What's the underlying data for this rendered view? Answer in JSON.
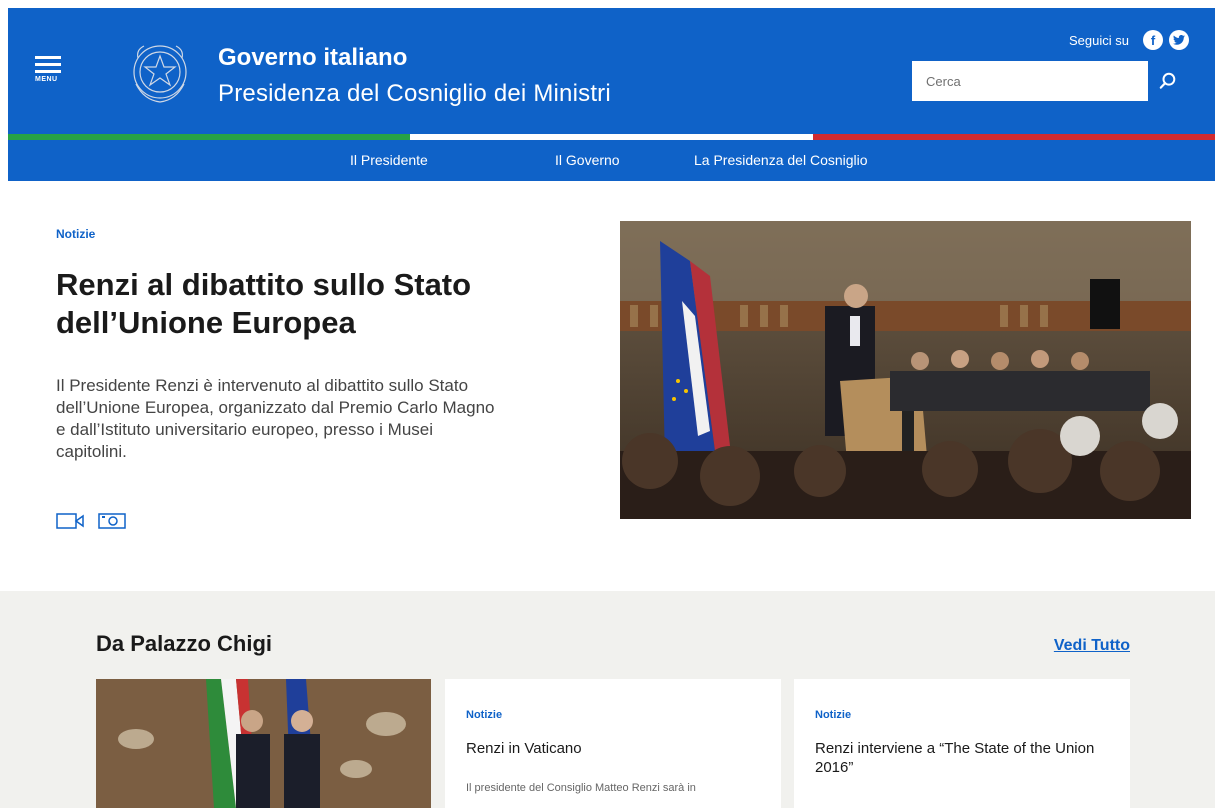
{
  "header": {
    "menu_label": "MENU",
    "title": "Governo italiano",
    "subtitle": "Presidenza del Cosniglio dei Ministri",
    "follow_label": "Seguici su",
    "social": [
      {
        "icon": "facebook-icon",
        "glyph": "f"
      },
      {
        "icon": "twitter-icon",
        "glyph": "t"
      }
    ],
    "search_placeholder": "Cerca",
    "colors": {
      "brand": "#0f62c8",
      "flag_green": "#27a245",
      "flag_white": "#ffffff",
      "flag_red": "#d12b2f"
    }
  },
  "nav": {
    "items": [
      {
        "label": "Il Presidente"
      },
      {
        "label": "Il Governo"
      },
      {
        "label": "La Presidenza del Cosniglio"
      }
    ]
  },
  "hero": {
    "category": "Notizie",
    "title": "Renzi al dibattito sullo Stato dell’Unione Europea",
    "description": "Il Presidente Renzi è intervenuto al dibattito sullo Stato dell’Unione Europea, organizzato dal Premio Carlo Magno e dall’Istituto universitario europeo, presso i Musei capitolini."
  },
  "section": {
    "title": "Da Palazzo Chigi",
    "see_all": "Vedi Tutto",
    "cards": [
      {
        "category": "Notizie",
        "title": "Renzi in Vaticano",
        "description": "Il presidente del Consiglio Matteo Renzi  sarà in"
      },
      {
        "category": "Notizie",
        "title": "Renzi interviene a “The State of the Union 2016”",
        "description": ""
      }
    ]
  }
}
